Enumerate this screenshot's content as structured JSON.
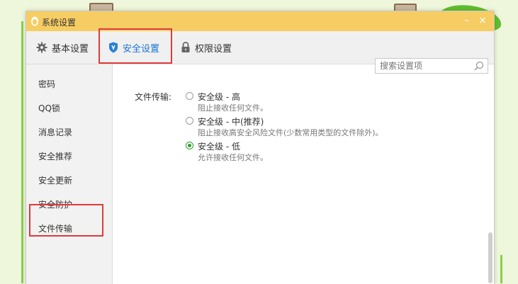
{
  "window": {
    "title": "系统设置",
    "minimize_symbol": "–",
    "close_symbol": "×",
    "app_icon": "qq-penguin-icon"
  },
  "tabs": [
    {
      "label": "基本设置",
      "icon": "gear-icon",
      "active": false
    },
    {
      "label": "安全设置",
      "icon": "shield-icon",
      "active": true
    },
    {
      "label": "权限设置",
      "icon": "lock-icon",
      "active": false
    }
  ],
  "search": {
    "placeholder": "搜索设置项"
  },
  "sidebar": {
    "items": [
      {
        "label": "密码"
      },
      {
        "label": "QQ锁"
      },
      {
        "label": "消息记录"
      },
      {
        "label": "安全推荐"
      },
      {
        "label": "安全更新"
      },
      {
        "label": "安全防护"
      },
      {
        "label": "文件传输",
        "selected": true
      }
    ]
  },
  "content": {
    "field_label": "文件传输:",
    "options": [
      {
        "title": "安全级 - 高",
        "desc": "阻止接收任何文件。",
        "checked": false
      },
      {
        "title": "安全级 - 中(推荐)",
        "desc": "阻止接收高安全风险文件(少数常用类型的文件除外)。",
        "checked": false
      },
      {
        "title": "安全级 - 低",
        "desc": "允许接收任何文件。",
        "checked": true
      }
    ]
  },
  "colors": {
    "titlebar": "#f6cd63",
    "accent": "#1976d2",
    "highlight": "#e03a3a",
    "radio_checked": "#2e9e2e"
  }
}
